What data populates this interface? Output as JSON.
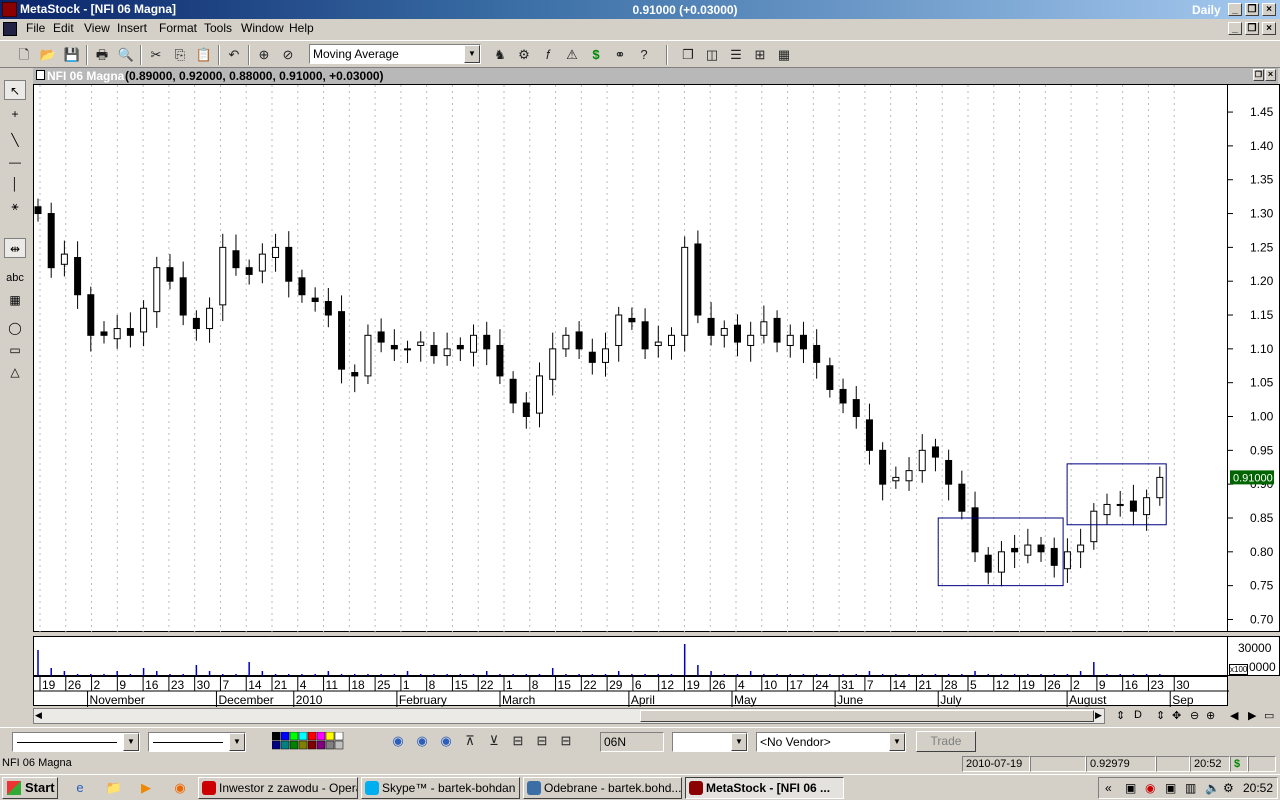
{
  "window": {
    "title": "MetaStock - [NFI 06 Magna]",
    "center_value": "0.91000 (+0.03000)",
    "period": "Daily"
  },
  "menu": [
    "File",
    "Edit",
    "View",
    "Insert",
    "Format",
    "Tools",
    "Window",
    "Help"
  ],
  "toolbar": {
    "indicator_select": "Moving Average"
  },
  "chart_window": {
    "name": "NFI 06 Magna",
    "values": "(0.89000, 0.92000, 0.88000, 0.91000, +0.03000)"
  },
  "price_axis": {
    "ticks": [
      "1.45",
      "1.40",
      "1.35",
      "1.30",
      "1.25",
      "1.20",
      "1.15",
      "1.10",
      "1.05",
      "1.00",
      "0.95",
      "0.90",
      "0.85",
      "0.80",
      "0.75",
      "0.70"
    ],
    "last_price": "0.91000"
  },
  "volume_axis": {
    "top": "30000",
    "bottom": "0000",
    "multiplier": "x100"
  },
  "date_axis": {
    "days": [
      "19",
      "26",
      "2",
      "9",
      "16",
      "23",
      "30",
      "7",
      "14",
      "21",
      "4",
      "11",
      "18",
      "25",
      "1",
      "8",
      "15",
      "22",
      "1",
      "8",
      "15",
      "22",
      "29",
      "6",
      "12",
      "19",
      "26",
      "4",
      "10",
      "17",
      "24",
      "31",
      "7",
      "14",
      "21",
      "28",
      "5",
      "12",
      "19",
      "26",
      "2",
      "9",
      "16",
      "23",
      "30"
    ],
    "months": [
      "November",
      "December",
      "2010",
      "February",
      "March",
      "April",
      "May",
      "June",
      "July",
      "August",
      "Sep"
    ]
  },
  "chart_data": {
    "type": "candlestick",
    "ylim": [
      0.68,
      1.49
    ],
    "boxes": [
      {
        "from_date_index": 35,
        "to_date_index": 40,
        "top": 0.85,
        "bottom": 0.75
      },
      {
        "from_date_index": 40,
        "to_date_index": 44,
        "top": 0.93,
        "bottom": 0.84
      }
    ],
    "close_series": [
      1.3,
      1.22,
      1.24,
      1.18,
      1.12,
      1.12,
      1.13,
      1.12,
      1.16,
      1.22,
      1.2,
      1.15,
      1.13,
      1.16,
      1.25,
      1.22,
      1.21,
      1.24,
      1.25,
      1.2,
      1.18,
      1.17,
      1.15,
      1.07,
      1.06,
      1.12,
      1.11,
      1.1,
      1.1,
      1.11,
      1.09,
      1.1,
      1.1,
      1.12,
      1.1,
      1.06,
      1.02,
      1.0,
      1.06,
      1.1,
      1.12,
      1.1,
      1.08,
      1.1,
      1.15,
      1.14,
      1.1,
      1.11,
      1.12,
      1.25,
      1.15,
      1.12,
      1.13,
      1.11,
      1.12,
      1.14,
      1.11,
      1.12,
      1.1,
      1.08,
      1.04,
      1.02,
      1.0,
      0.95,
      0.9,
      0.91,
      0.92,
      0.95,
      0.94,
      0.9,
      0.86,
      0.8,
      0.77,
      0.8,
      0.8,
      0.81,
      0.8,
      0.78,
      0.8,
      0.81,
      0.86,
      0.87,
      0.87,
      0.86,
      0.88,
      0.91
    ],
    "volume_series": [
      9,
      3,
      2,
      1,
      1,
      1,
      2,
      1,
      3,
      2,
      1,
      1,
      4,
      2,
      1,
      1,
      5,
      2,
      1,
      1,
      1,
      1,
      2,
      1,
      1,
      1,
      1,
      1,
      2,
      1,
      1,
      1,
      1,
      1,
      2,
      1,
      1,
      1,
      1,
      3,
      1,
      1,
      1,
      1,
      2,
      1,
      1,
      1,
      1,
      11,
      4,
      2,
      1,
      1,
      2,
      1,
      1,
      1,
      1,
      1,
      1,
      1,
      1,
      2,
      1,
      1,
      1,
      1,
      1,
      1,
      1,
      2,
      1,
      1,
      1,
      1,
      1,
      1,
      1,
      2,
      5,
      1,
      1,
      1,
      1,
      1
    ]
  },
  "bottombar": {
    "symbol_field": "06N",
    "vendor_select": "<No Vendor>",
    "trade_button": "Trade"
  },
  "statusbar": {
    "security": "NFI 06 Magna",
    "date": "2010-07-19",
    "price": "0.92979",
    "time": "20:52"
  },
  "taskbar": {
    "start": "Start",
    "tasks": [
      "Inwestor z zawodu - Opera",
      "Skype™ - bartek-bohdan",
      "Odebrane - bartek.bohd...",
      "MetaStock - [NFI 06 ..."
    ],
    "clock": "20:52"
  }
}
